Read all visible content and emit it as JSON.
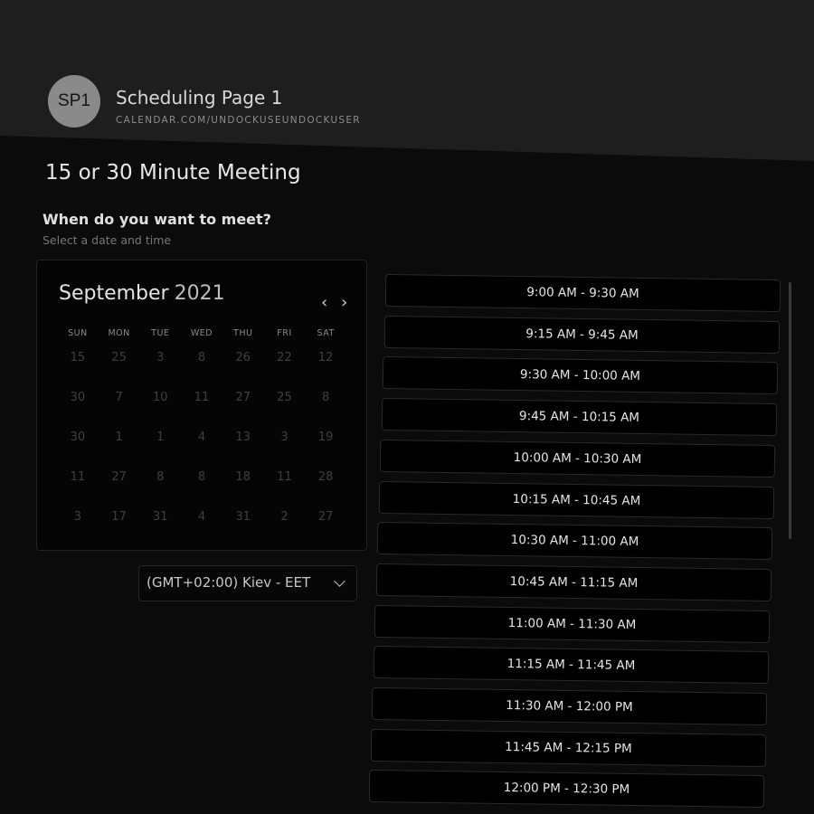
{
  "header": {
    "avatar_initials": "SP1",
    "page_name": "Scheduling Page 1",
    "page_url": "CALENDAR.COM/UNDOCKUSEUNDOCKUSER"
  },
  "meeting": {
    "title": "15 or 30 Minute Meeting",
    "question": "When do you want to meet?",
    "instruction": "Select a date and time"
  },
  "calendar": {
    "month": "September",
    "year": "2021",
    "prev_icon": "‹",
    "next_icon": "›",
    "weekdays": [
      "SUN",
      "MON",
      "TUE",
      "WED",
      "THU",
      "FRI",
      "SAT"
    ],
    "weeks": [
      [
        "15",
        "25",
        "3",
        "8",
        "26",
        "22",
        "12"
      ],
      [
        "30",
        "7",
        "10",
        "11",
        "27",
        "25",
        "8"
      ],
      [
        "30",
        "1",
        "1",
        "4",
        "13",
        "3",
        "19"
      ],
      [
        "11",
        "27",
        "8",
        "8",
        "18",
        "11",
        "28"
      ],
      [
        "3",
        "17",
        "31",
        "4",
        "31",
        "2",
        "27"
      ]
    ]
  },
  "timezone": {
    "selected": "(GMT+02:00) Kiev - EET"
  },
  "time_slots": [
    "9:00 AM - 9:30 AM",
    "9:15 AM - 9:45 AM",
    "9:30 AM - 10:00 AM",
    "9:45 AM - 10:15 AM",
    "10:00 AM - 10:30 AM",
    "10:15 AM - 10:45 AM",
    "10:30 AM - 11:00 AM",
    "10:45 AM - 11:15 AM",
    "11:00 AM - 11:30 AM",
    "11:15 AM - 11:45 AM",
    "11:30 AM - 12:00 PM",
    "11:45 AM - 12:15 PM",
    "12:00 PM - 12:30 PM"
  ],
  "colors": {
    "background": "#0b0b0b",
    "header": "#1e1e1e",
    "avatar": "#8a8a8a",
    "text": "#e6e6e6",
    "muted": "#777777"
  }
}
